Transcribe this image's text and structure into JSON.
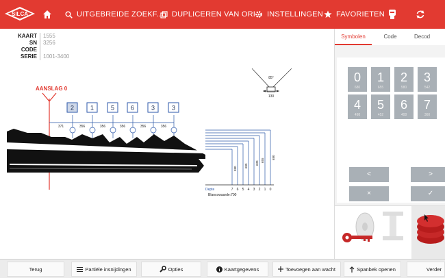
{
  "header": {
    "logo_text": "SILCA",
    "nav": [
      {
        "label": "UITGEBREIDE ZOEKF...",
        "icon": "search-icon"
      },
      {
        "label": "DUPLICEREN VAN ORI...",
        "icon": "duplicate-icon"
      },
      {
        "label": "INSTELLINGEN",
        "icon": "gear-icon"
      },
      {
        "label": "FAVORIETEN",
        "icon": "star-icon"
      }
    ],
    "colors": {
      "accent": "#e23a31"
    }
  },
  "info": {
    "rows": [
      {
        "key": "KAART",
        "value": "1555"
      },
      {
        "key": "SN",
        "value": "3256"
      },
      {
        "key": "CODE",
        "value": ""
      },
      {
        "key": "SERIE",
        "value": "1001-3400"
      }
    ]
  },
  "diagram": {
    "stop_label": "AANSLAG 0",
    "cuts": [
      "2",
      "1",
      "5",
      "6",
      "3",
      "3"
    ],
    "spacings": [
      "371",
      "356",
      "356",
      "356",
      "356",
      "356"
    ],
    "angle_label": "85°",
    "angle_width": "130",
    "depth_label": "Depte",
    "depth_numbers": [
      "7",
      "6",
      "5",
      "4",
      "3",
      "2",
      "1",
      "0"
    ],
    "depth_values": [
      "580",
      "605",
      "630",
      "655",
      "680"
    ],
    "blank_label": "Blancowaarde:700"
  },
  "panel": {
    "tabs": [
      "Symbolen",
      "Code",
      "Decod"
    ],
    "active_tab": 0,
    "digits": [
      {
        "n": "0",
        "s": "680"
      },
      {
        "n": "1",
        "s": "655"
      },
      {
        "n": "2",
        "s": "580"
      },
      {
        "n": "3",
        "s": "542"
      },
      {
        "n": "4",
        "s": "498"
      },
      {
        "n": "5",
        "s": "452"
      },
      {
        "n": "6",
        "s": "408"
      },
      {
        "n": "7",
        "s": "360"
      }
    ],
    "nav_buttons": [
      "<",
      ">",
      "×",
      "✓"
    ]
  },
  "footer": {
    "buttons": [
      {
        "label": "Terug",
        "icon": ""
      },
      {
        "label": "Partiële insnijdingen",
        "icon": "list-icon"
      },
      {
        "label": "Opties",
        "icon": "wrench-icon"
      },
      {
        "label": "Kaartgegevens",
        "icon": "info-icon"
      },
      {
        "label": "Toevoegen aan wacht",
        "icon": "plus-icon"
      },
      {
        "label": "Spanbek openen",
        "icon": "arrow-up-icon"
      },
      {
        "label": "Verder",
        "icon": ""
      }
    ]
  }
}
